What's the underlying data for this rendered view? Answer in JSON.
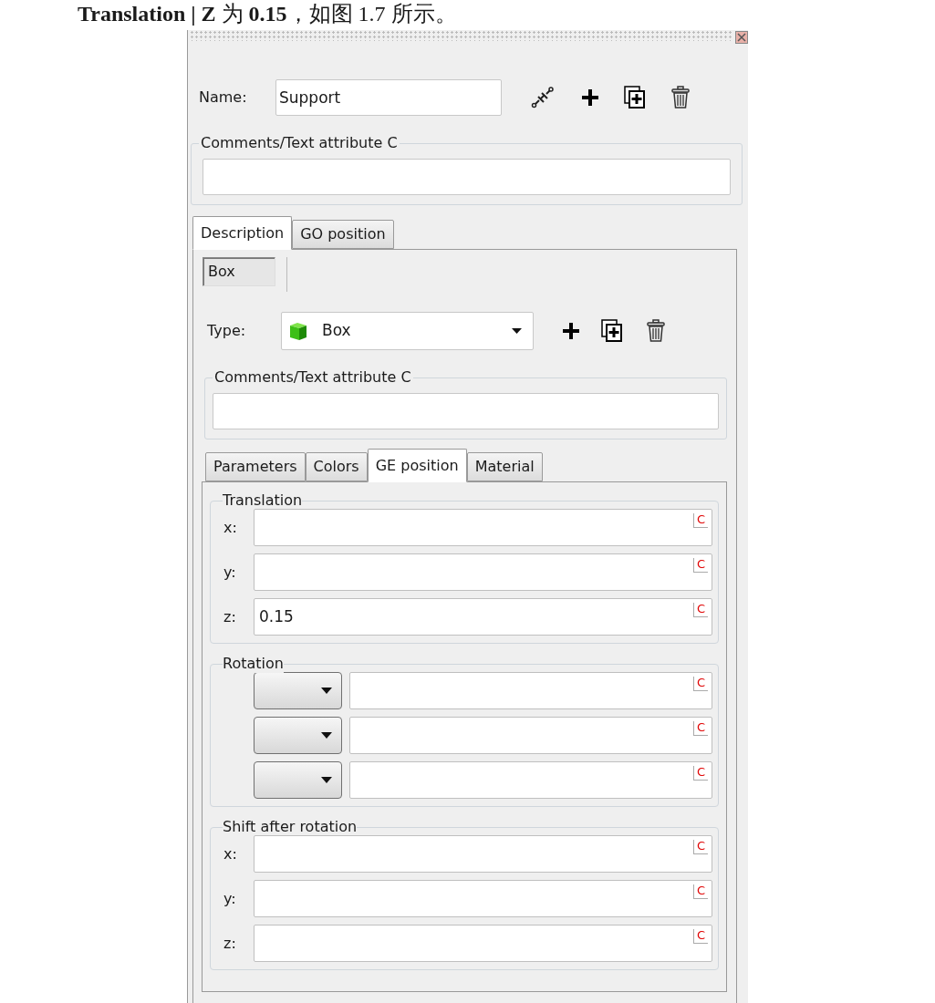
{
  "caption": "**Translation | Z** 为 **0.15**，如图 1.7 所示。",
  "name_field": {
    "label": "Name:",
    "value": "Support"
  },
  "comments": {
    "legend": "Comments/Text attribute C"
  },
  "main_tabs": [
    {
      "label": "Description",
      "selected": true
    },
    {
      "label": "GO position",
      "selected": false
    }
  ],
  "sub_tabs": [
    {
      "label": "Box",
      "selected": true
    }
  ],
  "type_field": {
    "label": "Type:",
    "value": "Box"
  },
  "type_comments": {
    "legend": "Comments/Text attribute C"
  },
  "ge_tabs": [
    {
      "label": "Parameters",
      "selected": false
    },
    {
      "label": "Colors",
      "selected": false
    },
    {
      "label": "GE position",
      "selected": true
    },
    {
      "label": "Material",
      "selected": false
    }
  ],
  "groups": [
    {
      "legend": "Translation",
      "rows": [
        {
          "kind": "labeled",
          "label": "x:",
          "button": "C"
        },
        {
          "kind": "labeled",
          "label": "y:",
          "button": "C"
        },
        {
          "kind": "labeled",
          "label": "z:",
          "value": "0.15",
          "button": "C"
        }
      ]
    },
    {
      "legend": "Rotation",
      "rows": [
        {
          "kind": "dropdown",
          "button": "C"
        },
        {
          "kind": "dropdown",
          "button": "C"
        },
        {
          "kind": "dropdown",
          "button": "C"
        }
      ]
    },
    {
      "legend": "Shift after rotation",
      "rows": [
        {
          "kind": "labeled",
          "label": "x:",
          "button": "C"
        },
        {
          "kind": "labeled",
          "label": "y:",
          "button": "C"
        },
        {
          "kind": "labeled",
          "label": "z:",
          "button": "C"
        }
      ]
    }
  ]
}
